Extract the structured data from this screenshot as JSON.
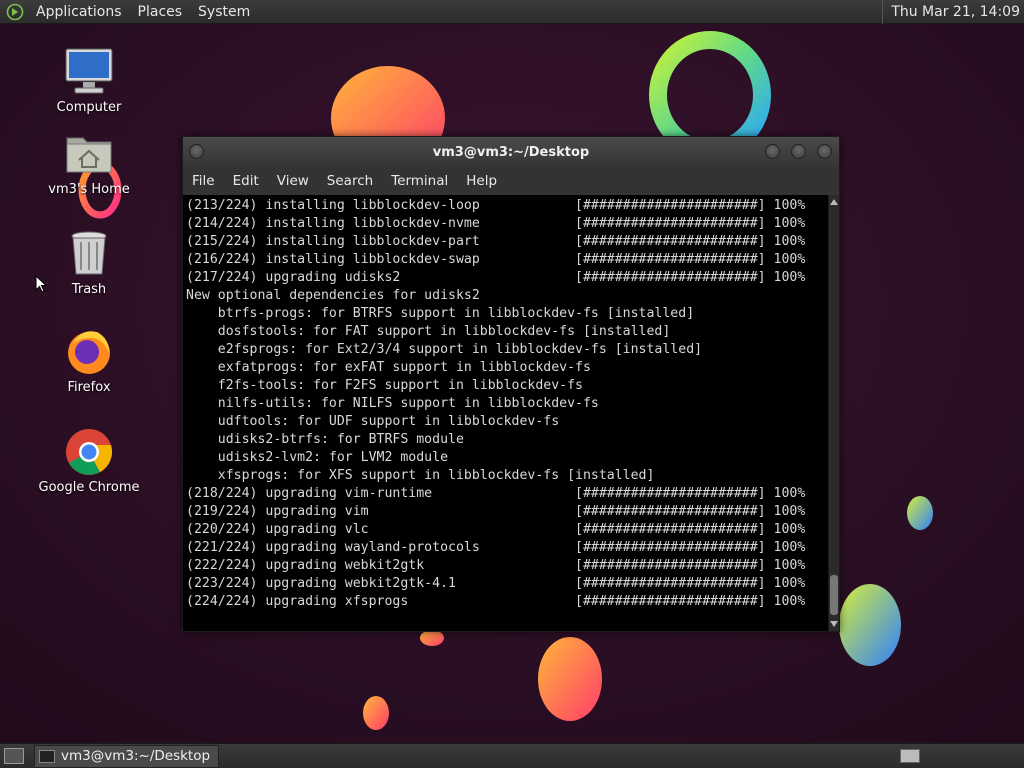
{
  "top_panel": {
    "menus": [
      "Applications",
      "Places",
      "System"
    ],
    "clock": "Thu Mar 21, 14:09"
  },
  "desktop_icons": [
    {
      "label": "Computer",
      "icon": "computer-icon"
    },
    {
      "label": "vm3's Home",
      "icon": "home-folder-icon"
    },
    {
      "label": "Trash",
      "icon": "trash-icon"
    },
    {
      "label": "Firefox",
      "icon": "firefox-icon"
    },
    {
      "label": "Google Chrome",
      "icon": "chrome-icon"
    }
  ],
  "window": {
    "title": "vm3@vm3:~/Desktop",
    "menus": [
      "File",
      "Edit",
      "View",
      "Search",
      "Terminal",
      "Help"
    ],
    "terminal_lines": [
      "(213/224) installing libblockdev-loop            [######################] 100%",
      "(214/224) installing libblockdev-nvme            [######################] 100%",
      "(215/224) installing libblockdev-part            [######################] 100%",
      "(216/224) installing libblockdev-swap            [######################] 100%",
      "(217/224) upgrading udisks2                      [######################] 100%",
      "New optional dependencies for udisks2",
      "    btrfs-progs: for BTRFS support in libblockdev-fs [installed]",
      "    dosfstools: for FAT support in libblockdev-fs [installed]",
      "    e2fsprogs: for Ext2/3/4 support in libblockdev-fs [installed]",
      "    exfatprogs: for exFAT support in libblockdev-fs",
      "    f2fs-tools: for F2FS support in libblockdev-fs",
      "    nilfs-utils: for NILFS support in libblockdev-fs",
      "    udftools: for UDF support in libblockdev-fs",
      "    udisks2-btrfs: for BTRFS module",
      "    udisks2-lvm2: for LVM2 module",
      "    xfsprogs: for XFS support in libblockdev-fs [installed]",
      "(218/224) upgrading vim-runtime                  [######################] 100%",
      "(219/224) upgrading vim                          [######################] 100%",
      "(220/224) upgrading vlc                          [######################] 100%",
      "(221/224) upgrading wayland-protocols            [######################] 100%",
      "(222/224) upgrading webkit2gtk                   [######################] 100%",
      "(223/224) upgrading webkit2gtk-4.1               [######################] 100%",
      "(224/224) upgrading xfsprogs                     [######################] 100%"
    ]
  },
  "taskbar": {
    "task_label": "vm3@vm3:~/Desktop"
  },
  "colors": {
    "wallpaper": "#2a0f24",
    "panel": "#333333",
    "terminal_bg": "#000000",
    "terminal_fg": "#d8d8d8"
  }
}
